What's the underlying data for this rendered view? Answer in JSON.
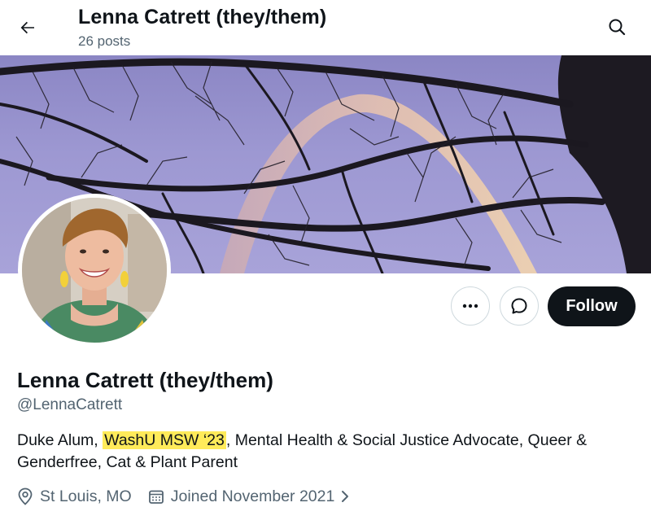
{
  "header": {
    "name": "Lenna Catrett (they/them)",
    "posts": "26 posts",
    "back_icon": "arrow-left-icon",
    "search_icon": "search-icon"
  },
  "profile": {
    "display_name": "Lenna Catrett (they/them)",
    "handle": "@LennaCatrett",
    "bio": {
      "before": "Duke Alum, ",
      "highlight": "WashU MSW ‘23",
      "after": ", Mental Health & Social Justice Advocate, Queer & Genderfree, Cat & Plant Parent"
    },
    "location": "St Louis, MO",
    "joined": "Joined November 2021"
  },
  "actions": {
    "more_icon": "more-horizontal-icon",
    "message_icon": "message-icon",
    "follow_label": "Follow"
  },
  "colors": {
    "text": "#0f1419",
    "secondary": "#536471",
    "highlight": "#ffeb5a",
    "button_dark": "#0f1419",
    "sky": "#9d98d2"
  }
}
